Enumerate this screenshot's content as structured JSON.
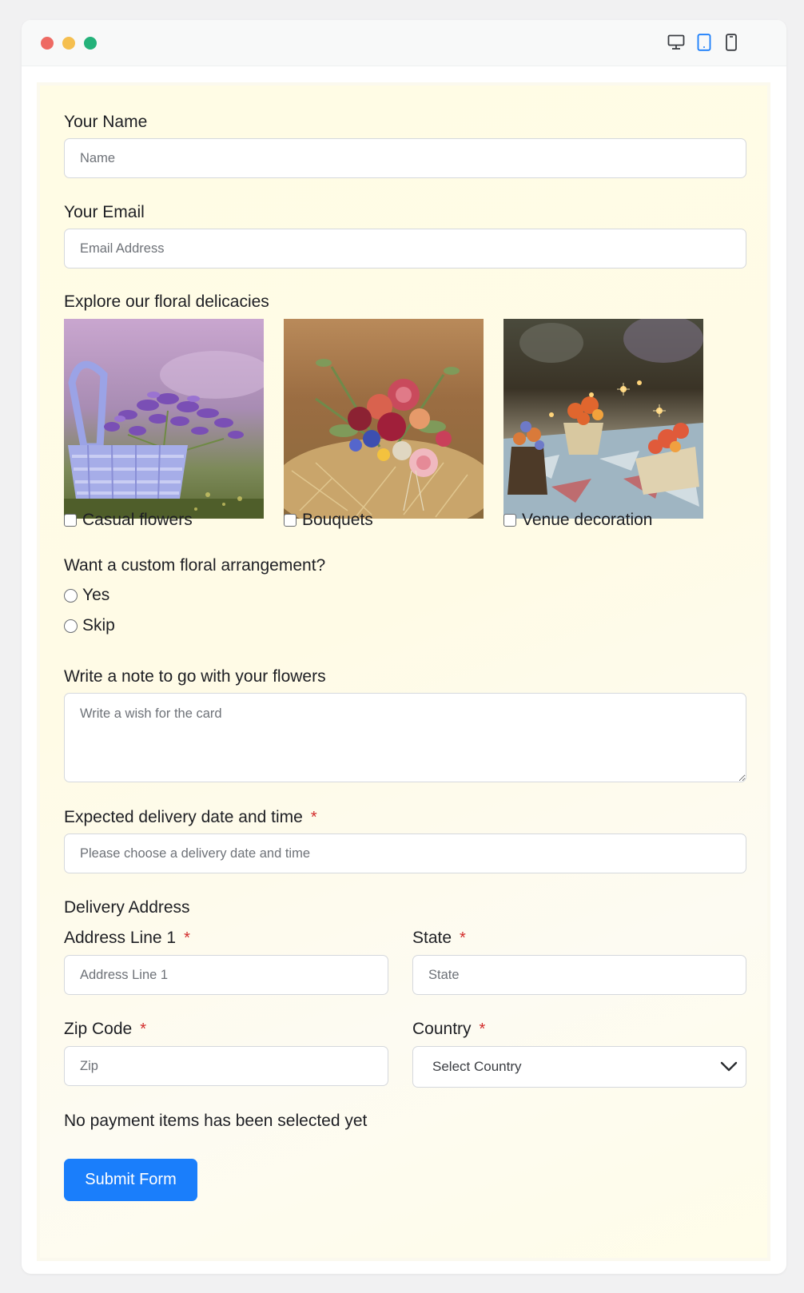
{
  "window": {
    "device_icons": [
      "desktop-icon",
      "tablet-icon",
      "mobile-icon"
    ],
    "active_device": "tablet"
  },
  "form": {
    "name": {
      "label": "Your Name",
      "placeholder": "Name"
    },
    "email": {
      "label": "Your Email",
      "placeholder": "Email Address"
    },
    "services": {
      "label": "Explore our floral delicacies",
      "options": [
        {
          "label": "Casual flowers",
          "image": "lavender-basket"
        },
        {
          "label": "Bouquets",
          "image": "bouquet-on-hay"
        },
        {
          "label": "Venue decoration",
          "image": "table-flower-decor"
        }
      ]
    },
    "custom": {
      "label": "Want a custom floral arrangement?",
      "options": [
        "Yes",
        "Skip"
      ]
    },
    "note": {
      "label": "Write a note to go with your flowers",
      "placeholder": "Write a wish for the card"
    },
    "delivery": {
      "label": "Expected delivery date and time",
      "required_mark": "*",
      "placeholder": "Please choose a delivery date and time"
    },
    "address": {
      "section_label": "Delivery Address",
      "line1": {
        "label": "Address Line 1",
        "required_mark": "*",
        "placeholder": "Address Line 1"
      },
      "state": {
        "label": "State",
        "required_mark": "*",
        "placeholder": "State"
      },
      "zip": {
        "label": "Zip Code",
        "required_mark": "*",
        "placeholder": "Zip"
      },
      "country": {
        "label": "Country",
        "required_mark": "*",
        "selected": "Select Country"
      }
    },
    "payment_note": "No payment items has been selected yet",
    "submit_label": "Submit Form"
  },
  "colors": {
    "primary": "#1a7efb",
    "required": "#d22a2a",
    "form_background": "#fffce5",
    "dot_red": "#ee6a63",
    "dot_yellow": "#f5bf4f",
    "dot_green": "#24b27a"
  }
}
